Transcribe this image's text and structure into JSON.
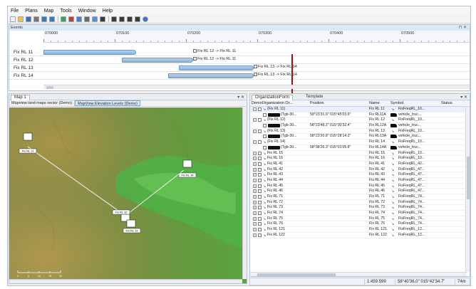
{
  "menu": [
    "File",
    "Plans",
    "Map",
    "Tools",
    "Window",
    "Help"
  ],
  "toolbar_icons": [
    "new-icon",
    "open-icon",
    "save-icon",
    "print-icon",
    "undo-icon",
    "redo-icon",
    "import-icon",
    "delete-icon",
    "zoom-icon",
    "pan-icon",
    "layers-icon",
    "screenshot-icon",
    "rewind-icon",
    "step-back-icon",
    "step-forward-icon",
    "forward-icon",
    "globe-icon"
  ],
  "events": {
    "title": "Events",
    "pin": "⊓ ✕",
    "ruler_labels": [
      "070000",
      "070100",
      "070200",
      "070300",
      "070400",
      "070500"
    ],
    "rows": [
      {
        "label": "Fix RL 11",
        "event": "Fix RL 12 -> Fix RL 11"
      },
      {
        "label": "Fix RL 12",
        "event": "Fix RL 12 -> Fix RL 11"
      },
      {
        "label": "Fix RL 13",
        "event": "Fix RL 13 -> Fix RL 14"
      },
      {
        "label": "Fix RL 14",
        "event": "Fix RL 13 -> Fix RL 14"
      }
    ]
  },
  "map_panel": {
    "tab": "Map 1",
    "ctrl": "▾ ✕",
    "layer_tabs": [
      "Mapview land maps vector (Demo)",
      "MapView Elevation Levels (Demo)"
    ]
  },
  "org_panel": {
    "tabs": [
      "OrganizationForm",
      "Template"
    ],
    "ctrl": "▾ ✕",
    "columns": [
      "DemoOrganization Or...",
      "Position",
      "Name",
      "Symbol",
      "Status"
    ],
    "rows": [
      {
        "kind": "group",
        "org": "(Fix RL 11)",
        "pos": "",
        "name": "Fix RL 11",
        "sym": "FixFreqRL_10..."
      },
      {
        "kind": "child",
        "org": "(Tgb-30...",
        "pos": "58°23'31.0\" 015°45'03.9\"",
        "name": "Fix RL11A",
        "sym": "vehicle_truc..."
      },
      {
        "kind": "group",
        "org": "(Fix RL 12)",
        "pos": "",
        "name": "Fix RL 12",
        "sym": "FixFreqRL_10..."
      },
      {
        "kind": "child",
        "org": "(Tgb-30...",
        "pos": "58°23'48.2\" 015°30'32.4\"",
        "name": "Fix RL12A",
        "sym": "vehicle_truc..."
      },
      {
        "kind": "group",
        "org": "(Fix RL 13)",
        "pos": "",
        "name": "Fix RL 13",
        "sym": "FixFreqRL_10..."
      },
      {
        "kind": "child",
        "org": "(Tgb-30...",
        "pos": "58°23'20.8\" 015°28'14.3\"",
        "name": "Fix RL13A",
        "sym": "vehicle_truc..."
      },
      {
        "kind": "group",
        "org": "(Fix RL 14)",
        "pos": "",
        "name": "Fix RL 14",
        "sym": "FixFreqRL_10..."
      },
      {
        "kind": "child",
        "org": "(Tgb-30...",
        "pos": "58°38'26.3\" 015°01'05.8\"",
        "name": "Fix RL14A",
        "sym": "vehicle_truc..."
      },
      {
        "kind": "leaf",
        "org": "Fix RL 15",
        "pos": "",
        "name": "Fix RL 15",
        "sym": "FixFreqRL_10..."
      },
      {
        "kind": "leaf",
        "org": "Fix RL 16",
        "pos": "",
        "name": "Fix RL 16",
        "sym": "FixFreqRL_10..."
      },
      {
        "kind": "leaf",
        "org": "Fix RL 41",
        "pos": "",
        "name": "Fix RL 41",
        "sym": "FixFreqRL_42..."
      },
      {
        "kind": "leaf",
        "org": "Fix RL 42",
        "pos": "",
        "name": "Fix RL 42",
        "sym": "FixFreqRL_47..."
      },
      {
        "kind": "leaf",
        "org": "Fix RL 43",
        "pos": "",
        "name": "Fix RL 43",
        "sym": "FixFreqRL_47..."
      },
      {
        "kind": "leaf",
        "org": "Fix RL 44",
        "pos": "",
        "name": "Fix RL 44",
        "sym": "FixFreqRL_47..."
      },
      {
        "kind": "leaf",
        "org": "Fix RL 45",
        "pos": "",
        "name": "Fix RL 45",
        "sym": "FixFreqRL_47..."
      },
      {
        "kind": "leaf",
        "org": "Fix RL 46",
        "pos": "",
        "name": "Fix RL 46",
        "sym": "FixFreqRL_47..."
      },
      {
        "kind": "leaf",
        "org": "Fix RL 71",
        "pos": "",
        "name": "Fix RL 71",
        "sym": "FixFreqRL_74..."
      },
      {
        "kind": "leaf",
        "org": "Fix RL 72",
        "pos": "",
        "name": "Fix RL 72",
        "sym": "FixFreqRL_74..."
      },
      {
        "kind": "leaf",
        "org": "Fix RL 73",
        "pos": "",
        "name": "Fix RL 73",
        "sym": "FixFreqRL_74..."
      },
      {
        "kind": "leaf",
        "org": "Fix RL 74",
        "pos": "",
        "name": "Fix RL 74",
        "sym": "FixFreqRL_74..."
      },
      {
        "kind": "leaf",
        "org": "Fix RL 75",
        "pos": "",
        "name": "Fix RL 75",
        "sym": "FixFreqRL_74..."
      },
      {
        "kind": "leaf",
        "org": "Fix RL 76",
        "pos": "",
        "name": "Fix RL 76",
        "sym": "FixFreqRL_74..."
      },
      {
        "kind": "leaf",
        "org": "Fix RL 121",
        "pos": "",
        "name": "Fix RL 121",
        "sym": "FixFreqRL_12..."
      },
      {
        "kind": "leaf",
        "org": "Fix RL 122",
        "pos": "",
        "name": "Fix RL 122",
        "sym": "FixFreqRL_12..."
      }
    ]
  },
  "status": {
    "scale": "1:459 599",
    "coords": "58°40'36.0\" 015°42'34.7\"",
    "elevation": "74m"
  },
  "map": {
    "markers": [
      {
        "label": "Fix RL 11"
      },
      {
        "label": "Fix RL 12"
      },
      {
        "label": "Fix RL 13"
      },
      {
        "label": "Fix RL 14"
      }
    ],
    "scale_labels": [
      "0",
      "5",
      "10",
      "15",
      "20"
    ]
  },
  "colors": {
    "accent": "#4a7cc0",
    "cursor": "#9b1010",
    "lowland": "#4fa33a",
    "highland": "#9c8e52"
  }
}
